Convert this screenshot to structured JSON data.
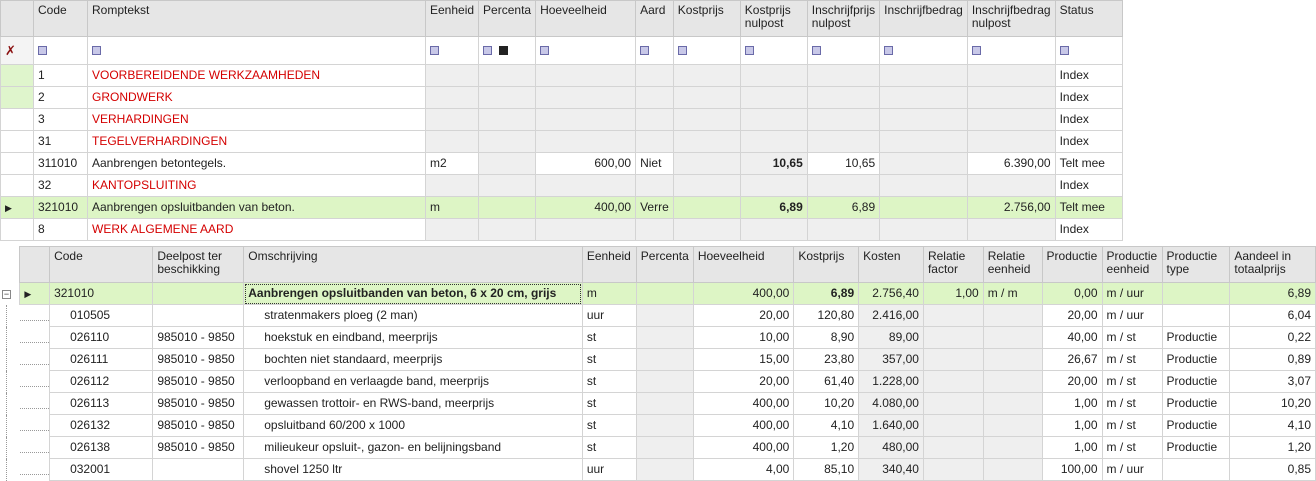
{
  "top_grid": {
    "columns": [
      "Code",
      "Romptekst",
      "Eenheid",
      "Percenta",
      "Hoeveelheid",
      "Aard",
      "Kostprijs",
      "Kostprijs nulpost",
      "Inschrijfprijs nulpost",
      "Inschrijfbedrag",
      "Inschrijfbedrag nulpost",
      "Status"
    ],
    "rows": [
      {
        "code": "1",
        "text": "VOORBEREIDENDE WERKZAAMHEDEN",
        "eenheid": "",
        "hoeveelheid": "",
        "aard": "",
        "kp_nul": "",
        "ip_nul": "",
        "ib_nul": "",
        "status": "Index"
      },
      {
        "code": "2",
        "text": "GRONDWERK",
        "eenheid": "",
        "hoeveelheid": "",
        "aard": "",
        "kp_nul": "",
        "ip_nul": "",
        "ib_nul": "",
        "status": "Index"
      },
      {
        "code": "3",
        "text": "VERHARDINGEN",
        "eenheid": "",
        "hoeveelheid": "",
        "aard": "",
        "kp_nul": "",
        "ip_nul": "",
        "ib_nul": "",
        "status": "Index"
      },
      {
        "code": "31",
        "text": "TEGELVERHARDINGEN",
        "eenheid": "",
        "hoeveelheid": "",
        "aard": "",
        "kp_nul": "",
        "ip_nul": "",
        "ib_nul": "",
        "status": "Index"
      },
      {
        "code": "311010",
        "text": "Aanbrengen betontegels.",
        "eenheid": "m2",
        "hoeveelheid": "600,00",
        "aard": "Niet",
        "kp_nul": "10,65",
        "ip_nul": "10,65",
        "ib_nul": "6.390,00",
        "status": "Telt mee"
      },
      {
        "code": "32",
        "text": "KANTOPSLUITING",
        "eenheid": "",
        "hoeveelheid": "",
        "aard": "",
        "kp_nul": "",
        "ip_nul": "",
        "ib_nul": "",
        "status": "Index"
      },
      {
        "code": "321010",
        "text": "Aanbrengen opsluitbanden van beton.",
        "eenheid": "m",
        "hoeveelheid": "400,00",
        "aard": "Verre",
        "kp_nul": "6,89",
        "ip_nul": "6,89",
        "ib_nul": "2.756,00",
        "status": "Telt mee"
      },
      {
        "code": "8",
        "text": "WERK ALGEMENE AARD",
        "eenheid": "",
        "hoeveelheid": "",
        "aard": "",
        "kp_nul": "",
        "ip_nul": "",
        "ib_nul": "",
        "status": "Index"
      }
    ]
  },
  "bottom_grid": {
    "columns": [
      "Code",
      "Deelpost ter beschikking",
      "Omschrijving",
      "Eenheid",
      "Percenta",
      "Hoeveelheid",
      "Kostprijs",
      "Kosten",
      "Relatie factor",
      "Relatie eenheid",
      "Productie",
      "Productie eenheid",
      "Productie type",
      "Aandeel in totaalprijs"
    ],
    "parent": {
      "code": "321010",
      "deelpost": "",
      "omschrijving": "Aanbrengen opsluitbanden van beton, 6 x 20 cm, grijs",
      "eenheid": "m",
      "hoeveelheid": "400,00",
      "kostprijs": "6,89",
      "kosten": "2.756,40",
      "rel_factor": "1,00",
      "rel_eenheid": "m / m",
      "productie": "0,00",
      "prod_eenheid": "m / uur",
      "prod_type": "",
      "aandeel": "6,89"
    },
    "rows": [
      {
        "code": "010505",
        "deelpost": "",
        "omschrijving": "stratenmakers ploeg (2 man)",
        "eenheid": "uur",
        "hoeveelheid": "20,00",
        "kostprijs": "120,80",
        "kosten": "2.416,00",
        "productie": "20,00",
        "prod_eenheid": "m / uur",
        "prod_type": "",
        "aandeel": "6,04"
      },
      {
        "code": "026110",
        "deelpost": "985010 - 9850",
        "omschrijving": "hoekstuk en eindband, meerprijs",
        "eenheid": "st",
        "hoeveelheid": "10,00",
        "kostprijs": "8,90",
        "kosten": "89,00",
        "productie": "40,00",
        "prod_eenheid": "m / st",
        "prod_type": "Productie",
        "aandeel": "0,22"
      },
      {
        "code": "026111",
        "deelpost": "985010 - 9850",
        "omschrijving": "bochten niet standaard, meerprijs",
        "eenheid": "st",
        "hoeveelheid": "15,00",
        "kostprijs": "23,80",
        "kosten": "357,00",
        "productie": "26,67",
        "prod_eenheid": "m / st",
        "prod_type": "Productie",
        "aandeel": "0,89"
      },
      {
        "code": "026112",
        "deelpost": "985010 - 9850",
        "omschrijving": "verloopband en verlaagde band, meerprijs",
        "eenheid": "st",
        "hoeveelheid": "20,00",
        "kostprijs": "61,40",
        "kosten": "1.228,00",
        "productie": "20,00",
        "prod_eenheid": "m / st",
        "prod_type": "Productie",
        "aandeel": "3,07"
      },
      {
        "code": "026113",
        "deelpost": "985010 - 9850",
        "omschrijving": "gewassen trottoir- en RWS-band, meerprijs",
        "eenheid": "st",
        "hoeveelheid": "400,00",
        "kostprijs": "10,20",
        "kosten": "4.080,00",
        "productie": "1,00",
        "prod_eenheid": "m / st",
        "prod_type": "Productie",
        "aandeel": "10,20"
      },
      {
        "code": "026132",
        "deelpost": "985010 - 9850",
        "omschrijving": "opsluitband 60/200 x 1000",
        "eenheid": "st",
        "hoeveelheid": "400,00",
        "kostprijs": "4,10",
        "kosten": "1.640,00",
        "productie": "1,00",
        "prod_eenheid": "m / st",
        "prod_type": "Productie",
        "aandeel": "4,10"
      },
      {
        "code": "026138",
        "deelpost": "985010 - 9850",
        "omschrijving": "milieukeur opsluit-, gazon- en belijningsband",
        "eenheid": "st",
        "hoeveelheid": "400,00",
        "kostprijs": "1,20",
        "kosten": "480,00",
        "productie": "1,00",
        "prod_eenheid": "m / st",
        "prod_type": "Productie",
        "aandeel": "1,20"
      },
      {
        "code": "032001",
        "deelpost": "",
        "omschrijving": "shovel 1250 ltr",
        "eenheid": "uur",
        "hoeveelheid": "4,00",
        "kostprijs": "85,10",
        "kosten": "340,40",
        "productie": "100,00",
        "prod_eenheid": "m / uur",
        "prod_type": "",
        "aandeel": "0,85"
      }
    ]
  }
}
